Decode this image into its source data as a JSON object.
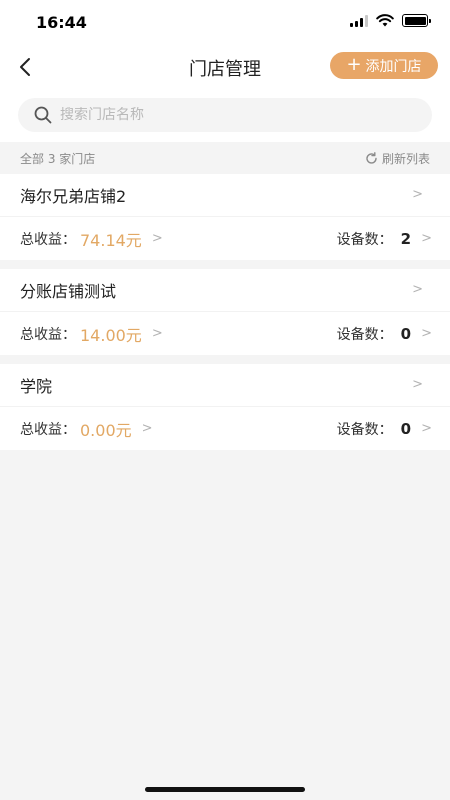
{
  "status": {
    "time": "16:44"
  },
  "nav": {
    "title": "门店管理",
    "add_plus": "+",
    "add_label": "添加门店"
  },
  "search": {
    "placeholder": "搜索门店名称",
    "value": ""
  },
  "summary": {
    "count_text": "全部 3 家门店",
    "refresh_label": "刷新列表"
  },
  "labels": {
    "income": "总收益：",
    "devices": "设备数：",
    "chevron": ">"
  },
  "stores": [
    {
      "name": "海尔兄弟店铺2",
      "income": "74.14元",
      "devices": "2"
    },
    {
      "name": "分账店铺测试",
      "income": "14.00元",
      "devices": "0"
    },
    {
      "name": "学院",
      "income": "0.00元",
      "devices": "0"
    }
  ],
  "colors": {
    "accent": "#e8a667",
    "income": "#e2a864",
    "background": "#f4f4f4"
  }
}
